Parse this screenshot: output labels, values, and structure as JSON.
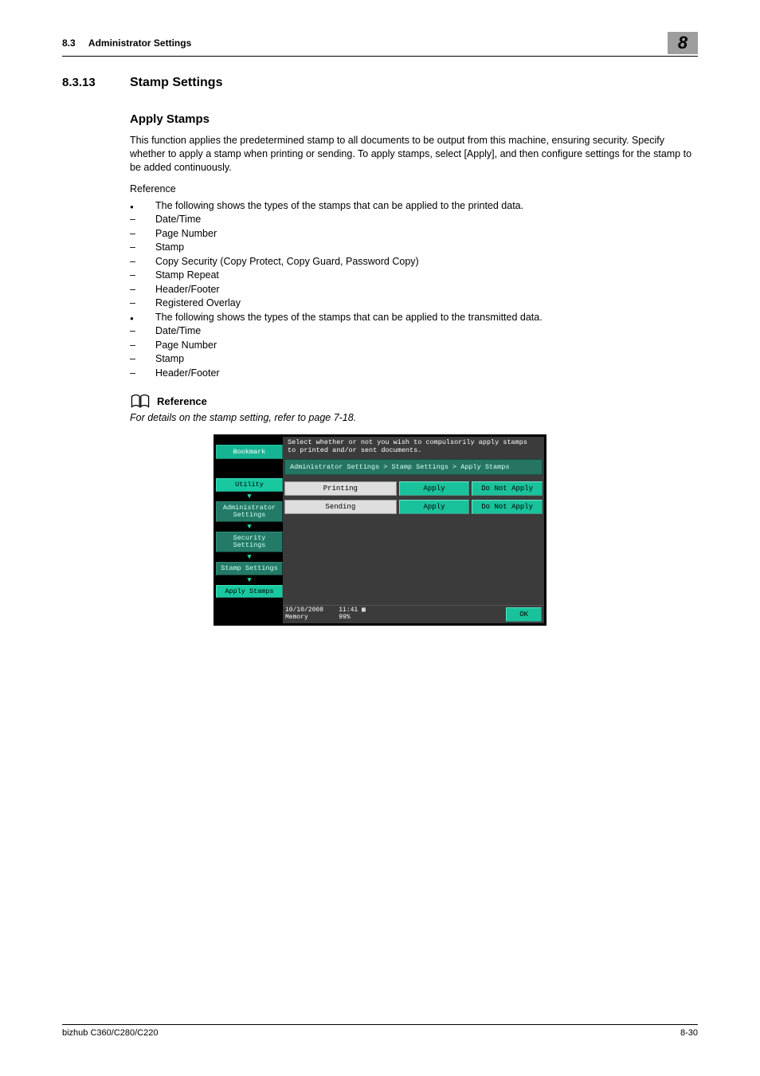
{
  "header": {
    "section_ref": "8.3",
    "section_name": "Administrator Settings",
    "chapter": "8"
  },
  "section": {
    "number": "8.3.13",
    "title": "Stamp Settings"
  },
  "subheading": "Apply Stamps",
  "paragraph": "This function applies the predetermined stamp to all documents to be output from this machine, ensuring security. Specify whether to apply a stamp when printing or sending. To apply stamps, select [Apply], and then configure settings for the stamp to be added continuously.",
  "reference_word": "Reference",
  "list": [
    {
      "m": "bullet",
      "t": "The following shows the types of the stamps that can be applied to the printed data."
    },
    {
      "m": "dash",
      "t": "Date/Time"
    },
    {
      "m": "dash",
      "t": "Page Number"
    },
    {
      "m": "dash",
      "t": "Stamp"
    },
    {
      "m": "dash",
      "t": "Copy Security (Copy Protect, Copy Guard, Password Copy)"
    },
    {
      "m": "dash",
      "t": "Stamp Repeat"
    },
    {
      "m": "dash",
      "t": "Header/Footer"
    },
    {
      "m": "dash",
      "t": "Registered Overlay"
    },
    {
      "m": "bullet",
      "t": "The following shows the types of the stamps that can be applied to the transmitted data."
    },
    {
      "m": "dash",
      "t": "Date/Time"
    },
    {
      "m": "dash",
      "t": "Page Number"
    },
    {
      "m": "dash",
      "t": "Stamp"
    },
    {
      "m": "dash",
      "t": "Header/Footer"
    }
  ],
  "refbox": {
    "label": "Reference",
    "text": "For details on the stamp setting, refer to page 7-18."
  },
  "device": {
    "instruction": "Select whether or not you wish to compulsorily apply stamps to printed and/or sent documents.",
    "breadcrumb": "Administrator Settings > Stamp Settings > Apply Stamps",
    "side": {
      "bookmark": "Bookmark",
      "utility": "Utility",
      "admin": "Administrator\nSettings",
      "security": "Security\nSettings",
      "stamp": "Stamp Settings",
      "apply": "Apply Stamps"
    },
    "rows": [
      {
        "label": "Printing",
        "apply": "Apply",
        "na": "Do Not Apply"
      },
      {
        "label": "Sending",
        "apply": "Apply",
        "na": "Do Not Apply"
      }
    ],
    "status": {
      "date": "10/10/2008",
      "time": "11:41",
      "mem_label": "Memory",
      "mem_val": "99%"
    },
    "ok": "OK"
  },
  "footer": {
    "model": "bizhub C360/C280/C220",
    "page": "8-30"
  }
}
